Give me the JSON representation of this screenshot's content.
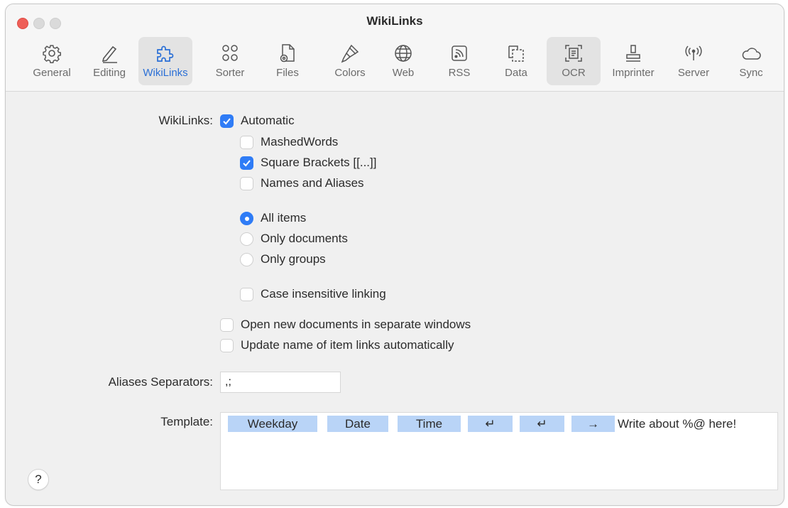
{
  "window": {
    "title": "WikiLinks"
  },
  "toolbar": {
    "tabs": [
      {
        "label": "General",
        "icon": "gear-icon"
      },
      {
        "label": "Editing",
        "icon": "pencil-icon"
      },
      {
        "label": "WikiLinks",
        "icon": "puzzle-icon"
      },
      {
        "label": "Sorter",
        "icon": "circles-icon"
      },
      {
        "label": "Files",
        "icon": "file-gear-icon"
      },
      {
        "label": "Colors",
        "icon": "brush-icon"
      },
      {
        "label": "Web",
        "icon": "globe-icon"
      },
      {
        "label": "RSS",
        "icon": "rss-icon"
      },
      {
        "label": "Data",
        "icon": "data-icon"
      },
      {
        "label": "OCR",
        "icon": "scan-icon"
      },
      {
        "label": "Imprinter",
        "icon": "stamp-icon"
      },
      {
        "label": "Server",
        "icon": "antenna-icon"
      },
      {
        "label": "Sync",
        "icon": "cloud-icon"
      }
    ],
    "active_tab": "WikiLinks",
    "accent_color": "#2f7cf6"
  },
  "settings": {
    "wikilinks_label": "WikiLinks:",
    "automatic": {
      "label": "Automatic",
      "checked": true
    },
    "mashed_words": {
      "label": "MashedWords",
      "checked": false
    },
    "square_brackets": {
      "label": "Square Brackets [[...]]",
      "checked": true
    },
    "names_aliases": {
      "label": "Names and Aliases",
      "checked": false
    },
    "scope": {
      "options": [
        "All items",
        "Only documents",
        "Only groups"
      ],
      "selected": "All items"
    },
    "case_insensitive": {
      "label": "Case insensitive linking",
      "checked": false
    },
    "open_new_docs": {
      "label": "Open new documents in separate windows",
      "checked": false
    },
    "update_names": {
      "label": "Update name of item links automatically",
      "checked": false
    },
    "aliases_separators": {
      "label": "Aliases Separators:",
      "value": ",;"
    },
    "template": {
      "label": "Template:",
      "tokens": [
        "Weekday",
        "Date",
        "Time",
        "↵",
        "↵",
        "→"
      ],
      "text": "Write about %@ here!"
    }
  },
  "help": {
    "label": "?"
  }
}
